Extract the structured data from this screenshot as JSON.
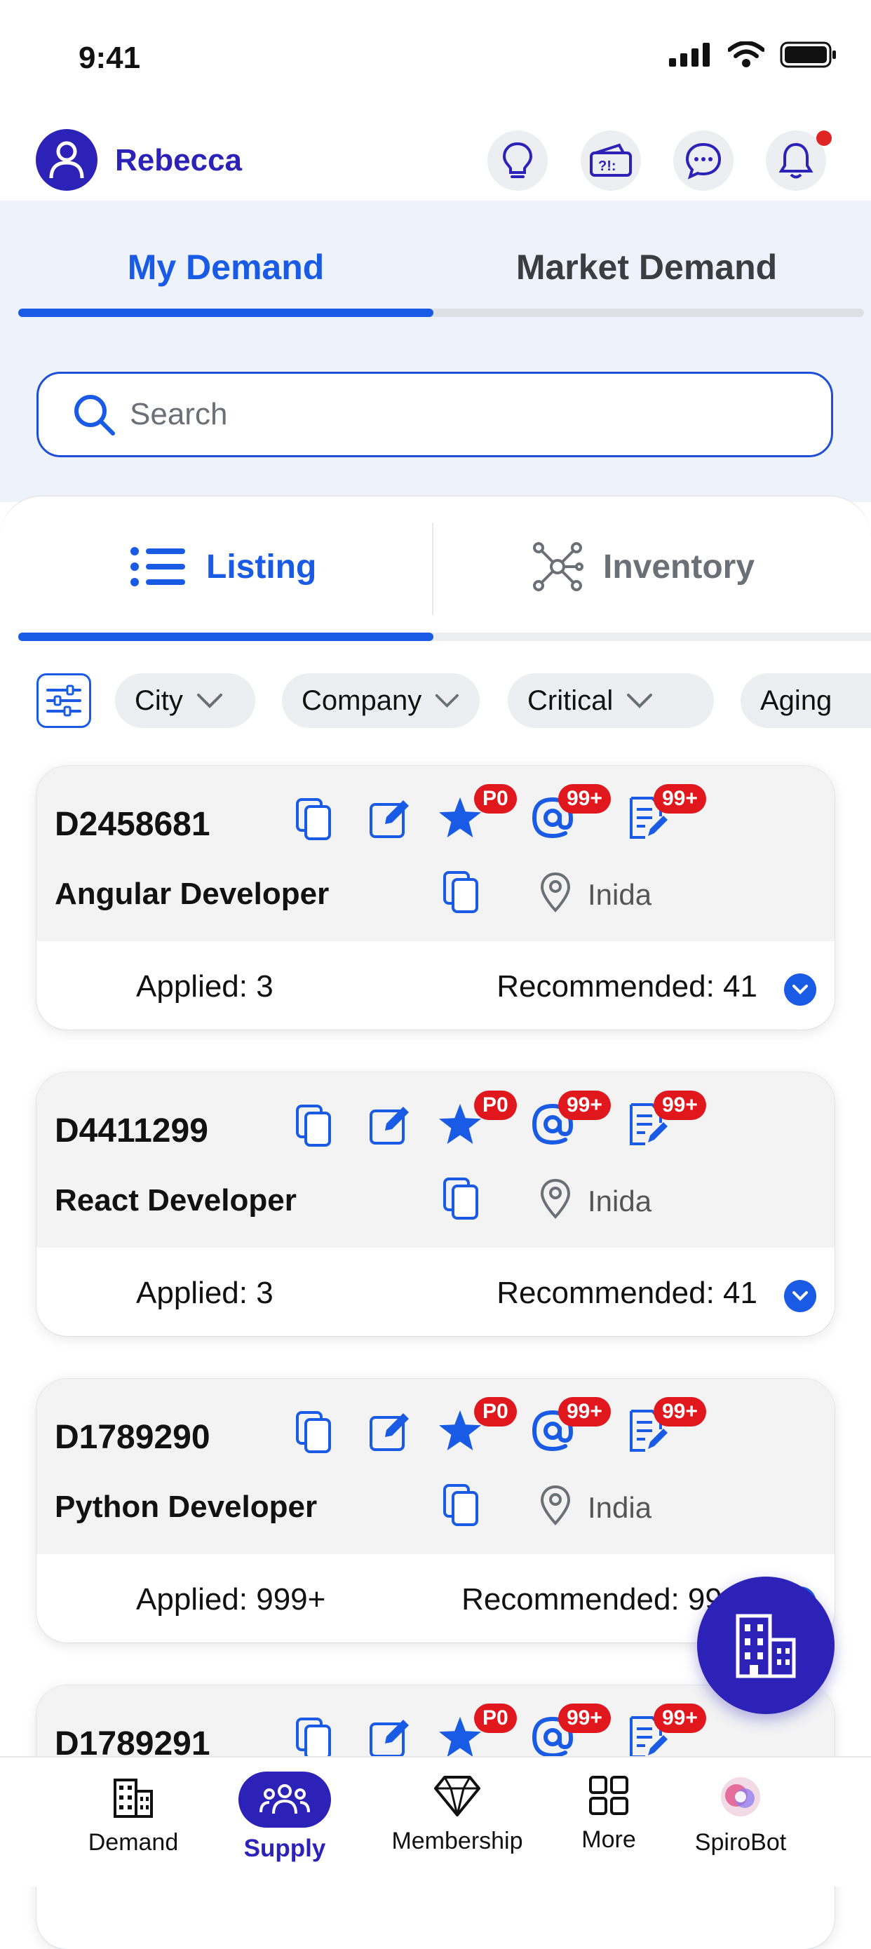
{
  "status_bar": {
    "time": "9:41"
  },
  "header": {
    "user_name": "Rebecca"
  },
  "demand_tabs": [
    {
      "label": "My Demand",
      "active": true
    },
    {
      "label": "Market Demand",
      "active": false
    }
  ],
  "search": {
    "placeholder": "Search",
    "value": ""
  },
  "view_tabs": [
    {
      "label": "Listing",
      "icon": "list-icon",
      "active": true
    },
    {
      "label": "Inventory",
      "icon": "network-icon",
      "active": false
    }
  ],
  "filters": [
    "City",
    "Company",
    "Critical",
    "Aging"
  ],
  "cards": [
    {
      "id": "D2458681",
      "role": "Angular Developer",
      "location": "Inida",
      "priority": "P0",
      "mentions": "99+",
      "notes": "99+",
      "applied": "Applied: 3",
      "recommended": "Recommended: 41"
    },
    {
      "id": "D4411299",
      "role": "React Developer",
      "location": "Inida",
      "priority": "P0",
      "mentions": "99+",
      "notes": "99+",
      "applied": "Applied: 3",
      "recommended": "Recommended: 41"
    },
    {
      "id": "D1789290",
      "role": "Python Developer",
      "location": "India",
      "priority": "P0",
      "mentions": "99+",
      "notes": "99+",
      "applied": "Applied: 999+",
      "recommended": "Recommended: 999+"
    },
    {
      "id": "D1789291",
      "priority": "P0",
      "mentions": "99+",
      "notes": "99+"
    }
  ],
  "bottom_nav": [
    {
      "label": "Demand",
      "icon": "building-icon",
      "active": false
    },
    {
      "label": "Supply",
      "icon": "people-icon",
      "active": true
    },
    {
      "label": "Membership",
      "icon": "diamond-icon",
      "active": false
    },
    {
      "label": "More",
      "icon": "grid-icon",
      "active": false
    },
    {
      "label": "SpiroBot",
      "icon": "spirobot-icon",
      "active": false
    }
  ],
  "colors": {
    "brand": "#2d22b8",
    "accent": "#1a5be6",
    "badge": "#e0181e"
  }
}
